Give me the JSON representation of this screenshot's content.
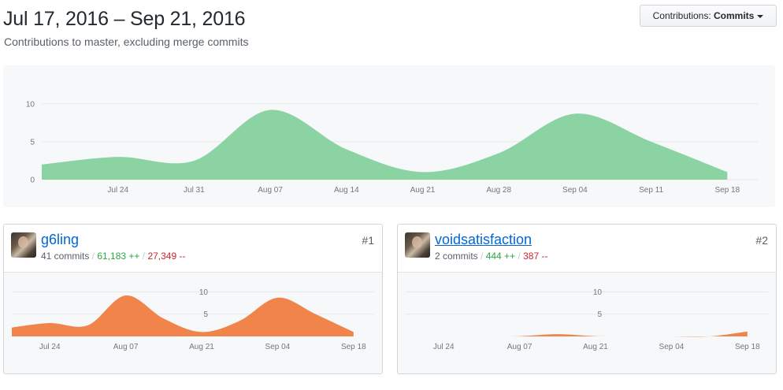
{
  "header": {
    "title": "Jul 17, 2016 – Sep 21, 2016",
    "subtitle": "Contributions to master, excluding merge commits",
    "contrib_label": "Contributions: ",
    "contrib_value": "Commits"
  },
  "colors": {
    "main_area": "#8cd3a3",
    "user_area": "#f1844b",
    "grid": "#e8e8e8"
  },
  "chart_data": [
    {
      "type": "area",
      "x": [
        "Jul 17",
        "Jul 24",
        "Jul 31",
        "Aug 07",
        "Aug 14",
        "Aug 21",
        "Aug 28",
        "Sep 04",
        "Sep 11",
        "Sep 18"
      ],
      "values": [
        2,
        3,
        2.5,
        9.2,
        4,
        1,
        3.5,
        8.7,
        5,
        1
      ],
      "x_ticks": [
        "Jul 24",
        "Jul 31",
        "Aug 07",
        "Aug 14",
        "Aug 21",
        "Aug 28",
        "Sep 04",
        "Sep 11",
        "Sep 18"
      ],
      "y_ticks": [
        "0",
        "5",
        "10"
      ],
      "ylim": [
        0,
        10.5
      ]
    },
    {
      "type": "area",
      "x": [
        "Jul 17",
        "Jul 24",
        "Jul 31",
        "Aug 07",
        "Aug 14",
        "Aug 21",
        "Aug 28",
        "Sep 04",
        "Sep 11",
        "Sep 18"
      ],
      "values": [
        2,
        3,
        2.5,
        9.2,
        4,
        1,
        3.5,
        8.7,
        5,
        1
      ],
      "x_ticks": [
        "Jul 24",
        "Aug 07",
        "Aug 21",
        "Sep 04",
        "Sep 18"
      ],
      "y_ticks": [
        "5",
        "10"
      ],
      "ylim": [
        0,
        11.5
      ]
    },
    {
      "type": "area",
      "x": [
        "Jul 17",
        "Jul 24",
        "Jul 31",
        "Aug 07",
        "Aug 14",
        "Aug 21",
        "Aug 28",
        "Sep 04",
        "Sep 11",
        "Sep 18"
      ],
      "values": [
        0,
        0,
        0,
        0.05,
        0.5,
        0.05,
        0,
        0,
        0,
        1.1
      ],
      "x_ticks": [
        "Jul 24",
        "Aug 07",
        "Aug 21",
        "Sep 04",
        "Sep 18"
      ],
      "y_ticks": [
        "5",
        "10"
      ],
      "ylim": [
        0,
        11.5
      ]
    }
  ],
  "contributors": [
    {
      "name": "g6ling",
      "commits": "41 commits",
      "sep1": " / ",
      "additions": "61,183 ++",
      "sep2": " / ",
      "deletions": "27,349 --",
      "rank": "#1"
    },
    {
      "name": "voidsatisfaction",
      "commits": "2 commits",
      "sep1": " / ",
      "additions": "444 ++",
      "sep2": " / ",
      "deletions": "387 --",
      "rank": "#2"
    }
  ]
}
